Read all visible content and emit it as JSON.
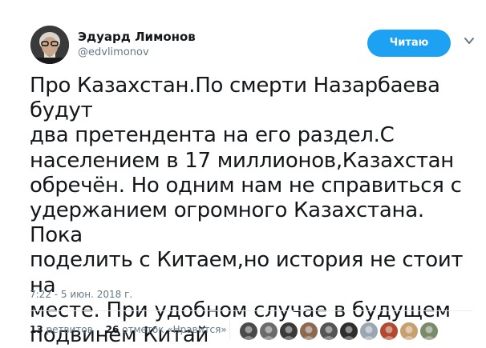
{
  "author": {
    "display_name": "Эдуард Лимонов",
    "username": "@edvlimonov"
  },
  "follow_button": {
    "label": "Читаю",
    "color": "#1da1f2"
  },
  "tweet": {
    "text": "Про Казахстан.По смерти Назарбаева будут\nдва претендента на его раздел.С\nнаселением в 17 миллионов,Казахстан\nобречён. Но одним нам не справиться с\nудержанием огромного Казахстана. Пока\nподелить с Китаем,но история не стоит на\nместе. При удобном случае в будущем\nподвинем Китай",
    "timestamp": "7:22 - 5 июн. 2018 г."
  },
  "stats": {
    "retweets_count": "13",
    "retweets_label": "ретвитов",
    "likes_count": "26",
    "likes_label": "отметок «Нравится»"
  },
  "likers_avatars": [
    {
      "icon": "avatar-thumbnail-icon",
      "color": "#4a4a4a"
    },
    {
      "icon": "avatar-thumbnail-icon",
      "color": "#6b6b6b"
    },
    {
      "icon": "avatar-thumbnail-icon",
      "color": "#3a3a3a"
    },
    {
      "icon": "avatar-thumbnail-icon",
      "color": "#8a6a50"
    },
    {
      "icon": "avatar-thumbnail-icon",
      "color": "#555555"
    },
    {
      "icon": "avatar-thumbnail-icon",
      "color": "#2e2e2e"
    },
    {
      "icon": "avatar-thumbnail-icon",
      "color": "#9aa7b3"
    },
    {
      "icon": "avatar-thumbnail-icon",
      "color": "#b04a30"
    },
    {
      "icon": "avatar-thumbnail-icon",
      "color": "#c8a070"
    },
    {
      "icon": "avatar-thumbnail-icon",
      "color": "#7a8a6a"
    }
  ],
  "colors": {
    "primary_text": "#14171a",
    "secondary_text": "#657786",
    "divider": "#e6ecf0"
  }
}
